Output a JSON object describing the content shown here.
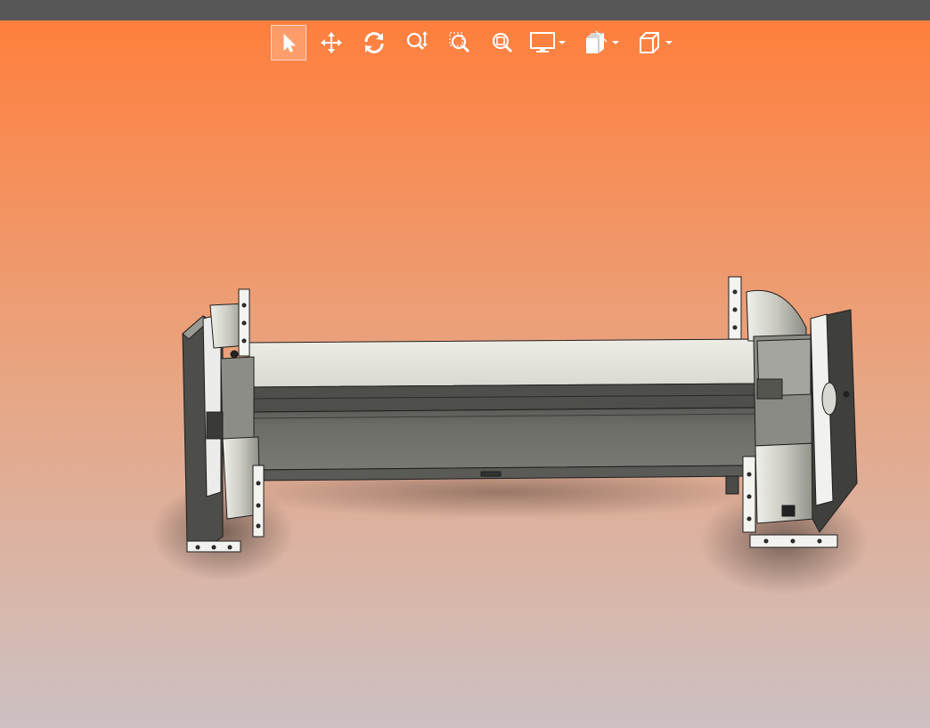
{
  "app": {
    "title_bar_color": "#575757",
    "background_gradient": [
      "#ff7f3d",
      "#e8a582",
      "#cdc1c3"
    ]
  },
  "toolbar": {
    "buttons": [
      {
        "name": "select",
        "icon": "arrow-pointer-icon",
        "active": true
      },
      {
        "name": "pan",
        "icon": "move-arrows-icon",
        "active": false
      },
      {
        "name": "rotate",
        "icon": "rotate-icon",
        "active": false
      },
      {
        "name": "zoom",
        "icon": "zoom-updown-icon",
        "active": false
      },
      {
        "name": "zoom-window",
        "icon": "zoom-window-icon",
        "active": false
      },
      {
        "name": "zoom-fit",
        "icon": "zoom-fit-icon",
        "active": false
      },
      {
        "name": "display-mode",
        "icon": "monitor-icon",
        "active": false,
        "has_dropdown": true
      },
      {
        "name": "view-section",
        "icon": "section-view-icon",
        "active": false,
        "has_dropdown": true
      },
      {
        "name": "view-orientation",
        "icon": "cube-icon",
        "active": false,
        "has_dropdown": true
      }
    ],
    "icon_color": "#ffffff",
    "active_border_color": "#f7d8c6"
  },
  "model": {
    "description_icon": "cad-assembly-icon",
    "body_light": "#e7e6df",
    "body_dark": "#5e5e5a",
    "body_mid": "#7a7a75",
    "edge_color": "#1e1e1e"
  }
}
